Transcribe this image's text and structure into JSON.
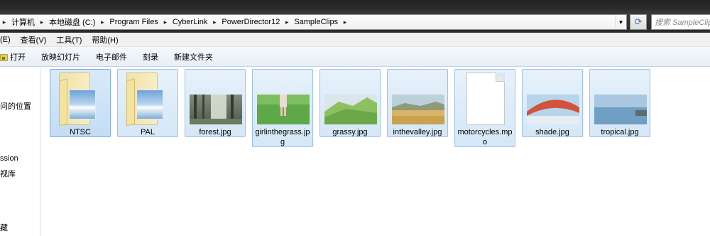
{
  "breadcrumbs": [
    "计算机",
    "本地磁盘 (C:)",
    "Program Files",
    "CyberLink",
    "PowerDirector12",
    "SampleClips"
  ],
  "search": {
    "placeholder": "搜索 SampleClips"
  },
  "menu": [
    "(E)",
    "查看(V)",
    "工具(T)",
    "帮助(H)"
  ],
  "toolbar": {
    "open": "打开",
    "slideshow": "放映幻灯片",
    "email": "电子邮件",
    "burn": "刻录",
    "new_folder": "新建文件夹"
  },
  "nav": [
    {
      "label": "问的位置"
    },
    {
      "label": "ssion"
    },
    {
      "label": "视库"
    },
    {
      "label": "藏"
    }
  ],
  "files": [
    {
      "name": "NTSC",
      "type": "folder"
    },
    {
      "name": "PAL",
      "type": "folder"
    },
    {
      "name": "forest.jpg",
      "type": "image",
      "icon": "forest-thumbnail"
    },
    {
      "name": "girlinthegrass.jpg",
      "type": "image",
      "icon": "girl-in-grass-thumbnail"
    },
    {
      "name": "grassy.jpg",
      "type": "image",
      "icon": "grass-thumbnail"
    },
    {
      "name": "inthevalley.jpg",
      "type": "image",
      "icon": "valley-thumbnail"
    },
    {
      "name": "motorcycles.mpo",
      "type": "file",
      "icon": "blank-file-icon"
    },
    {
      "name": "shade.jpg",
      "type": "image",
      "icon": "umbrella-thumbnail"
    },
    {
      "name": "tropical.jpg",
      "type": "image",
      "icon": "sea-thumbnail"
    }
  ]
}
